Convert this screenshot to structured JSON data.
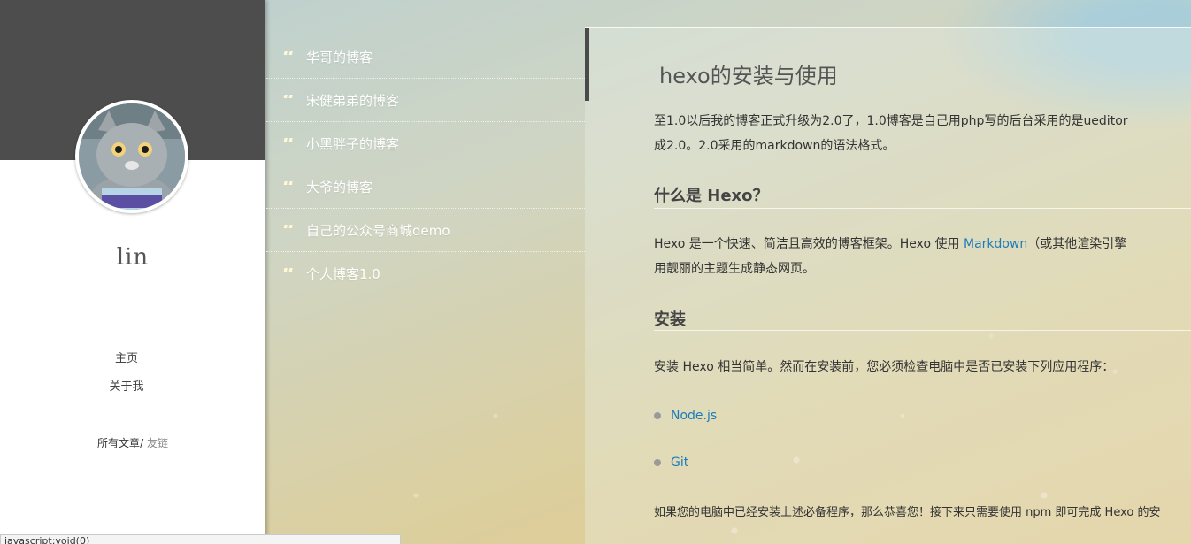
{
  "sidebar": {
    "author": "lin",
    "nav": [
      "主页",
      "关于我"
    ],
    "all_posts": "所有文章",
    "separator": "/",
    "friends": "友链"
  },
  "status_bar": "javascript:void(0)",
  "friend_links": [
    {
      "label": "华哥的博客",
      "icon": "quote-icon"
    },
    {
      "label": "宋健弟弟的博客",
      "icon": "quote-icon"
    },
    {
      "label": "小黑胖子的博客",
      "icon": "quote-icon"
    },
    {
      "label": "大爷的博客",
      "icon": "quote-icon"
    },
    {
      "label": "自己的公众号商城demo",
      "icon": "quote-icon"
    },
    {
      "label": "个人博客1.0",
      "icon": "quote-icon"
    }
  ],
  "article": {
    "title": "hexo的安装与使用",
    "intro_line1": "至1.0以后我的博客正式升级为2.0了，1.0博客是自己用php写的后台采用的是ueditor",
    "intro_line2": "成2.0。2.0采用的markdown的语法格式。",
    "h_what": "什么是 Hexo？",
    "hexo_desc_before": " Hexo 是一个快速、简洁且高效的博客框架。Hexo 使用 ",
    "hexo_desc_link": "Markdown",
    "hexo_desc_after": "（或其他渲染引擎",
    "hexo_desc_line2": "用靓丽的主题生成静态网页。",
    "h_install": "安装",
    "install_text": " 安装 Hexo 相当简单。然而在安装前，您必须检查电脑中是否已安装下列应用程序：",
    "requirements": [
      "Node.js",
      "Git"
    ],
    "after_text": "如果您的电脑中已经安装上述必备程序，那么恭喜您！接下来只需要使用 npm 即可完成 Hexo 的安"
  },
  "colors": {
    "header_dark": "#4d4d4d",
    "link": "#1e7bbb"
  }
}
